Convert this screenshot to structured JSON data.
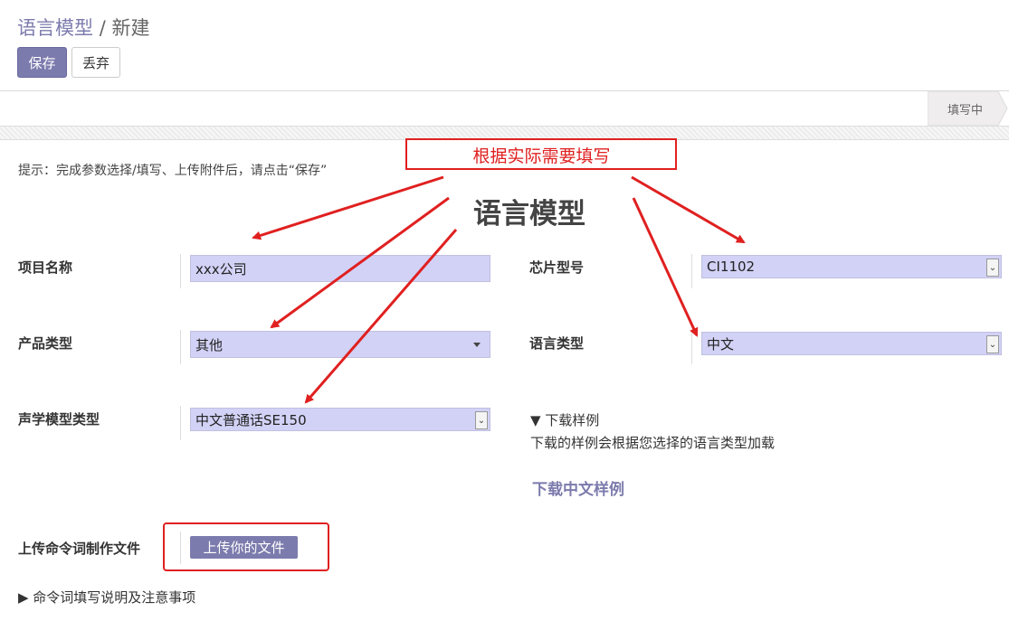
{
  "breadcrumb": {
    "parent": "语言模型",
    "separator": "/",
    "current": "新建"
  },
  "buttons": {
    "save": "保存",
    "discard": "丢弃"
  },
  "status": {
    "stage": "填写中"
  },
  "form": {
    "hint": "提示：完成参数选择/填写、上传附件后，请点击“保存”",
    "title": "语言模型",
    "project_name": {
      "label": "项目名称",
      "value": "xxx公司"
    },
    "chip_model": {
      "label": "芯片型号",
      "value": "CI1102"
    },
    "product_type": {
      "label": "产品类型",
      "value": "其他"
    },
    "language_type": {
      "label": "语言类型",
      "value": "中文"
    },
    "acoustic_model_type": {
      "label": "声学模型类型",
      "value": "中文普通话SE150"
    },
    "download": {
      "toggle": "▼ 下载样例",
      "note": "下载的样例会根据您选择的语言类型加载",
      "link": "下载中文样例"
    },
    "upload": {
      "label": "上传命令词制作文件",
      "button": "上传你的文件"
    },
    "instructions": "▶ 命令词填写说明及注意事项"
  },
  "annotation": {
    "callout": "根据实际需要填写",
    "color": "#e02020"
  },
  "colors": {
    "accent": "#7c7bad",
    "field_bg": "#d2d2f7"
  }
}
